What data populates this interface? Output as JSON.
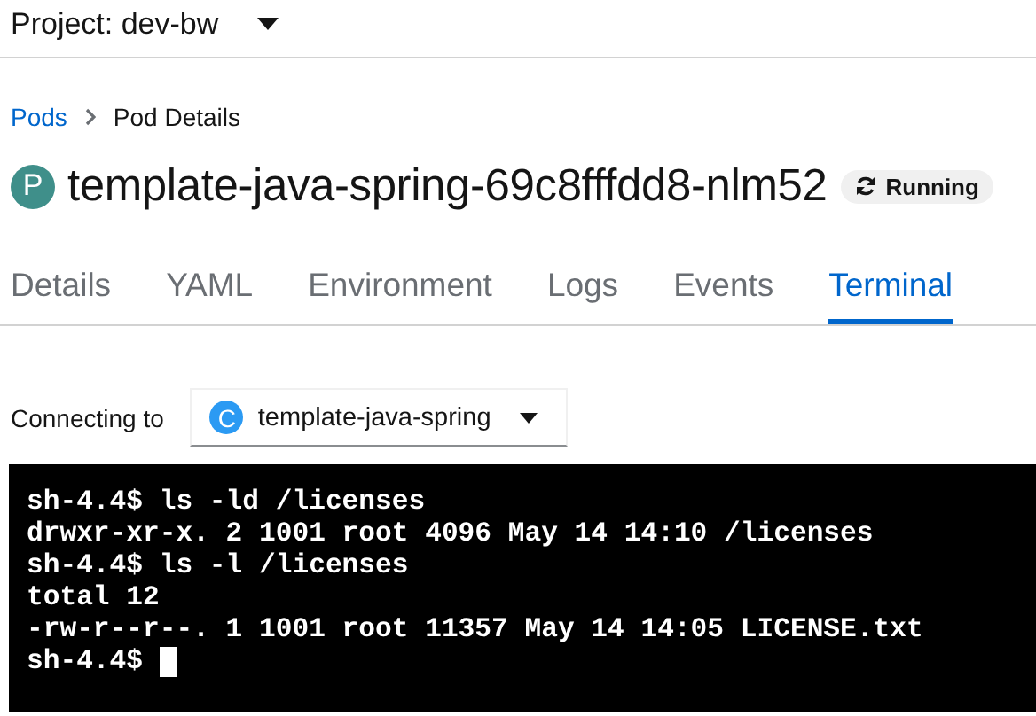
{
  "project": {
    "label": "Project: dev-bw"
  },
  "breadcrumb": [
    {
      "label": "Pods",
      "kind": "link"
    },
    {
      "label": "Pod Details",
      "kind": "current"
    }
  ],
  "header": {
    "badge": "P",
    "name": "template-java-spring-69c8fffdd8-nlm52",
    "status": "Running"
  },
  "tabs": [
    {
      "label": "Details",
      "selected": false
    },
    {
      "label": "YAML",
      "selected": false
    },
    {
      "label": "Environment",
      "selected": false
    },
    {
      "label": "Logs",
      "selected": false
    },
    {
      "label": "Events",
      "selected": false
    },
    {
      "label": "Terminal",
      "selected": true
    }
  ],
  "connection": {
    "label": "Connecting to",
    "badge": "C",
    "container": "template-java-spring"
  },
  "terminal": {
    "lines": [
      "sh-4.4$ ls -ld /licenses",
      "drwxr-xr-x. 2 1001 root 4096 May 14 14:10 /licenses",
      "sh-4.4$ ls -l /licenses",
      "total 12",
      "-rw-r--r--. 1 1001 root 11357 May 14 14:05 LICENSE.txt",
      "sh-4.4$ "
    ],
    "cursor": true
  }
}
